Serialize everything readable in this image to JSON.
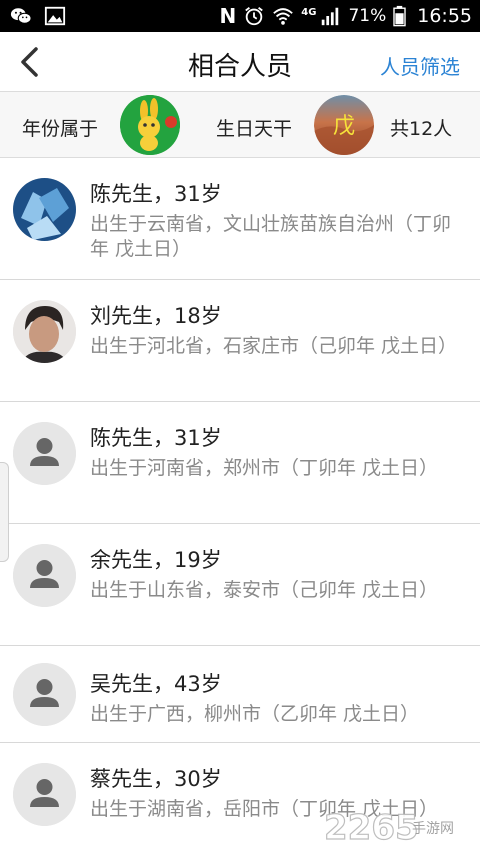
{
  "status_bar": {
    "left_icons": [
      "wechat-icon",
      "gallery-icon"
    ],
    "nfc_label": "N",
    "network_label": "4G",
    "battery": "71%",
    "time": "16:55"
  },
  "header": {
    "title": "相合人员",
    "filter_label": "人员筛选"
  },
  "filter_bar": {
    "year_label": "年份属于",
    "year_badge": "卯",
    "birthday_label": "生日天干",
    "birthday_badge": "戊",
    "count_label": "共12人"
  },
  "people": [
    {
      "name": "陈先生，31岁",
      "desc": "出生于云南省，文山壮族苗族自治州（丁卯年 戊土日）",
      "avatar": "photo-ice"
    },
    {
      "name": "刘先生，18岁",
      "desc": "出生于河北省，石家庄市（己卯年 戊土日）",
      "avatar": "photo-face"
    },
    {
      "name": "陈先生，31岁",
      "desc": "出生于河南省，郑州市（丁卯年 戊土日）",
      "avatar": "default"
    },
    {
      "name": "余先生，19岁",
      "desc": "出生于山东省，泰安市（己卯年 戊土日）",
      "avatar": "default"
    },
    {
      "name": "吴先生，43岁",
      "desc": "出生于广西，柳州市（乙卯年 戊土日）",
      "avatar": "default"
    },
    {
      "name": "蔡先生，30岁",
      "desc": "出生于湖南省，岳阳市（丁卯年 戊土日）",
      "avatar": "default"
    }
  ],
  "watermark": {
    "text": "2265",
    "sub": "手游网"
  },
  "colors": {
    "accent": "#2b83d4",
    "status_bar": "#000000",
    "secondary_text": "#8a8a8a"
  }
}
